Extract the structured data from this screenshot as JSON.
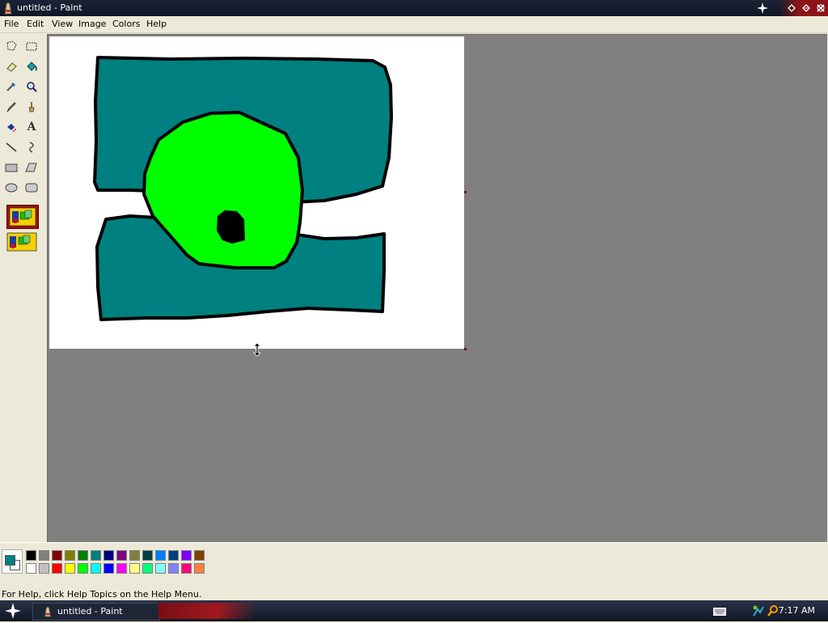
{
  "window": {
    "title": "untitled - Paint"
  },
  "menu": [
    "File",
    "Edit",
    "View",
    "Image",
    "Colors",
    "Help"
  ],
  "tools": [
    {
      "name": "free-form-select-tool-icon"
    },
    {
      "name": "select-tool-icon"
    },
    {
      "name": "eraser-tool-icon"
    },
    {
      "name": "fill-bucket-tool-icon"
    },
    {
      "name": "color-picker-tool-icon"
    },
    {
      "name": "magnifier-tool-icon"
    },
    {
      "name": "pencil-tool-icon"
    },
    {
      "name": "brush-tool-icon"
    },
    {
      "name": "airbrush-tool-icon"
    },
    {
      "name": "text-tool-icon"
    },
    {
      "name": "line-tool-icon"
    },
    {
      "name": "curve-tool-icon"
    },
    {
      "name": "rectangle-tool-icon"
    },
    {
      "name": "polygon-tool-icon"
    },
    {
      "name": "ellipse-tool-icon"
    },
    {
      "name": "rounded-rectangle-tool-icon"
    }
  ],
  "text_tool_glyph": "A",
  "palette": {
    "foreground": "#008080",
    "background": "#ffffff",
    "top_row": [
      "#000000",
      "#808080",
      "#800000",
      "#808000",
      "#008000",
      "#008080",
      "#000080",
      "#800080",
      "#808040",
      "#004040",
      "#0080ff",
      "#004080",
      "#8000ff",
      "#804000"
    ],
    "bottom_row": [
      "#ffffff",
      "#c0c0c0",
      "#ff0000",
      "#ffff00",
      "#00ff00",
      "#00ffff",
      "#0000ff",
      "#ff00ff",
      "#ffff80",
      "#00ff80",
      "#80ffff",
      "#8080ff",
      "#ff0080",
      "#ff8040"
    ]
  },
  "drawing": {
    "teal": "#008080",
    "green": "#00ff00",
    "black": "#000000"
  },
  "status": {
    "help_text": "For Help, click Help Topics on the Help Menu."
  },
  "taskbar": {
    "window_label": "untitled - Paint",
    "clock": "7:17 AM"
  }
}
